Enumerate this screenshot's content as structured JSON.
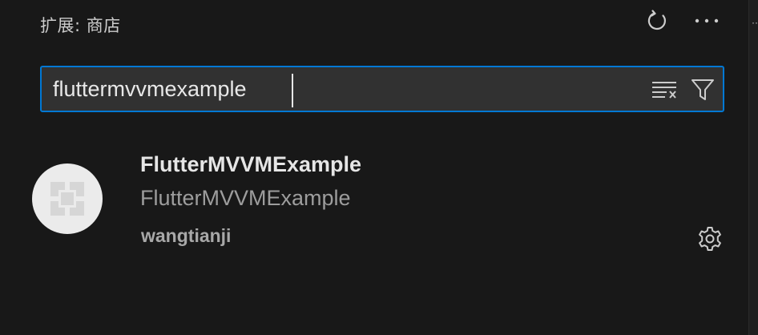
{
  "header": {
    "title": "扩展: 商店",
    "refresh_icon": "refresh-icon",
    "more_icon": "more-actions-icon"
  },
  "search": {
    "value": "fluttermvvmexample",
    "clear_icon": "clear-search-results-icon",
    "filter_icon": "filter-icon"
  },
  "results": [
    {
      "name": "FlutterMVVMExample",
      "description": "FlutterMVVMExample",
      "publisher": "wangtianji",
      "icon": "default-extension-icon",
      "manage_icon": "gear-icon"
    }
  ],
  "colors": {
    "background": "#181818",
    "focus_border": "#0078d4",
    "input_background": "#313131"
  }
}
